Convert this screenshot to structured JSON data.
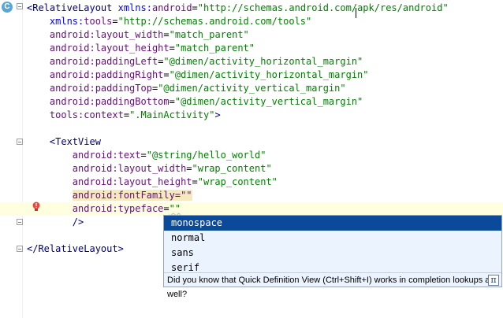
{
  "gutter": {
    "class_icon_letter": "C"
  },
  "code_lines": [
    [
      {
        "t": "<",
        "c": "tag"
      },
      {
        "t": "RelativeLayout ",
        "c": "tag"
      },
      {
        "t": "xmlns:",
        "c": "ns"
      },
      {
        "t": "android",
        "c": "attr"
      },
      {
        "t": "=",
        "c": "plain"
      },
      {
        "t": "\"http://schemas.android.com/apk/res/android\"",
        "c": "val"
      }
    ],
    [
      {
        "t": "    xmlns:",
        "c": "ns"
      },
      {
        "t": "tools",
        "c": "attr"
      },
      {
        "t": "=",
        "c": "plain"
      },
      {
        "t": "\"http://schemas.android.com/tools\"",
        "c": "val"
      }
    ],
    [
      {
        "t": "    android:",
        "c": "attr"
      },
      {
        "t": "layout_width",
        "c": "attr"
      },
      {
        "t": "=",
        "c": "plain"
      },
      {
        "t": "\"match_parent\"",
        "c": "val"
      }
    ],
    [
      {
        "t": "    android:",
        "c": "attr"
      },
      {
        "t": "layout_height",
        "c": "attr"
      },
      {
        "t": "=",
        "c": "plain"
      },
      {
        "t": "\"match_parent\"",
        "c": "val"
      }
    ],
    [
      {
        "t": "    android:",
        "c": "attr"
      },
      {
        "t": "paddingLeft",
        "c": "attr"
      },
      {
        "t": "=",
        "c": "plain"
      },
      {
        "t": "\"@dimen/activity_horizontal_margin\"",
        "c": "val"
      }
    ],
    [
      {
        "t": "    android:",
        "c": "attr"
      },
      {
        "t": "paddingRight",
        "c": "attr"
      },
      {
        "t": "=",
        "c": "plain"
      },
      {
        "t": "\"@dimen/activity_horizontal_margin\"",
        "c": "val"
      }
    ],
    [
      {
        "t": "    android:",
        "c": "attr"
      },
      {
        "t": "paddingTop",
        "c": "attr"
      },
      {
        "t": "=",
        "c": "plain"
      },
      {
        "t": "\"@dimen/activity_vertical_margin\"",
        "c": "val"
      }
    ],
    [
      {
        "t": "    android:",
        "c": "attr"
      },
      {
        "t": "paddingBottom",
        "c": "attr"
      },
      {
        "t": "=",
        "c": "plain"
      },
      {
        "t": "\"@dimen/activity_vertical_margin\"",
        "c": "val"
      }
    ],
    [
      {
        "t": "    tools:",
        "c": "attr"
      },
      {
        "t": "context",
        "c": "attr"
      },
      {
        "t": "=",
        "c": "plain"
      },
      {
        "t": "\".MainActivity\"",
        "c": "val"
      },
      {
        "t": ">",
        "c": "tag"
      }
    ],
    [],
    [
      {
        "t": "    <",
        "c": "tag"
      },
      {
        "t": "TextView",
        "c": "tag"
      }
    ],
    [
      {
        "t": "        android:",
        "c": "attr"
      },
      {
        "t": "text",
        "c": "attr"
      },
      {
        "t": "=",
        "c": "plain"
      },
      {
        "t": "\"@string/hello_world\"",
        "c": "val"
      }
    ],
    [
      {
        "t": "        android:",
        "c": "attr"
      },
      {
        "t": "layout_width",
        "c": "attr"
      },
      {
        "t": "=",
        "c": "plain"
      },
      {
        "t": "\"wrap_content\"",
        "c": "val"
      }
    ],
    [
      {
        "t": "        android:",
        "c": "attr"
      },
      {
        "t": "layout_height",
        "c": "attr"
      },
      {
        "t": "=",
        "c": "plain"
      },
      {
        "t": "\"wrap_content\"",
        "c": "val"
      }
    ],
    [
      {
        "t": "        ",
        "c": "plain"
      },
      {
        "t": "android:fontFamily=\"\"",
        "c": "attr",
        "hl": "attr"
      }
    ],
    [
      {
        "t": "        android:",
        "c": "attr"
      },
      {
        "t": "typeface",
        "c": "attr"
      },
      {
        "t": "=",
        "c": "plain"
      },
      {
        "t": "\"\"",
        "c": "val"
      }
    ],
    [
      {
        "t": "        />",
        "c": "tag"
      }
    ],
    [],
    [
      {
        "t": "</",
        "c": "tag"
      },
      {
        "t": "RelativeLayout",
        "c": "tag"
      },
      {
        "t": ">",
        "c": "tag"
      }
    ]
  ],
  "completion": {
    "items": [
      "monospace",
      "normal",
      "sans",
      "serif"
    ],
    "selected_index": 0,
    "hint": "Did you know that Quick Definition View (Ctrl+Shift+I) works in completion lookups as well?",
    "pi_icon_glyph": "π"
  },
  "colors": {
    "tag": "#000080",
    "attribute": "#660e7a",
    "value": "#008000",
    "caret_line": "#ffffdf",
    "popup_bg": "#ebf4fe",
    "popup_selected": "#0b4a9b"
  },
  "icons": [
    "class-icon",
    "fold-icon",
    "lightbulb-error-icon",
    "pi-icon"
  ]
}
